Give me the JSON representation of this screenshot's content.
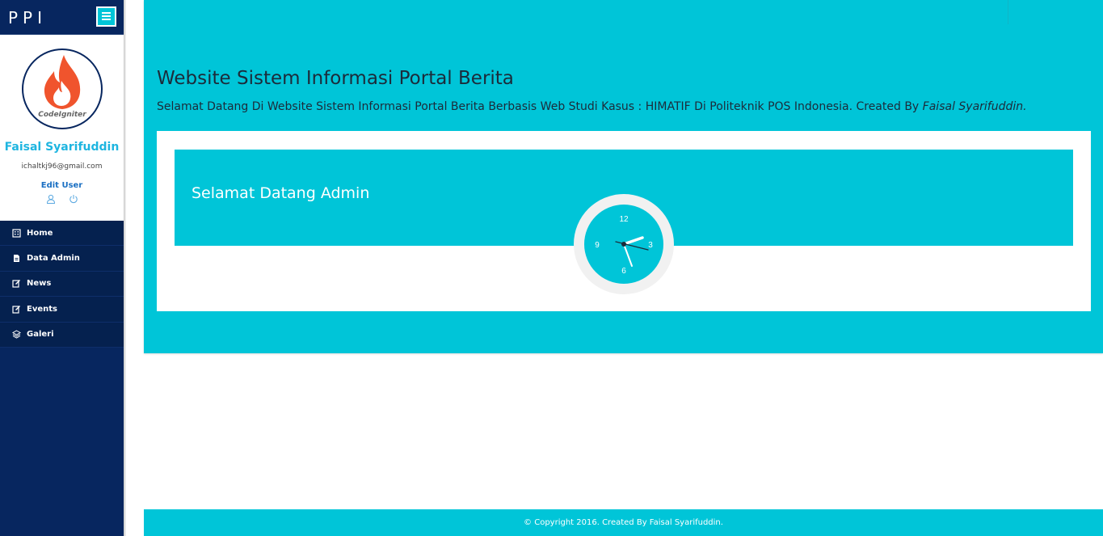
{
  "sidebar": {
    "brand": "PPI",
    "logo_text": "CodeIgniter",
    "user_name": "Faisal Syarifuddin",
    "user_email": "ichaltkj96@gmail.com",
    "edit_user_label": "Edit User",
    "items": [
      {
        "label": "Home",
        "icon": "building-icon"
      },
      {
        "label": "Data Admin",
        "icon": "file-icon"
      },
      {
        "label": "News",
        "icon": "edit-icon"
      },
      {
        "label": "Events",
        "icon": "edit-icon"
      },
      {
        "label": "Galeri",
        "icon": "layers-icon"
      }
    ]
  },
  "main": {
    "title": "Website Sistem Informasi Portal Berita",
    "subtitle": "Selamat Datang Di Website Sistem Informasi Portal Berita Berbasis Web Studi Kasus : HIMATIF Di Politeknik POS Indonesia. Created By",
    "subtitle_author": "Faisal Syarifuddin.",
    "welcome": "Selamat Datang Admin",
    "clock": {
      "n12": "12",
      "n3": "3",
      "n6": "6",
      "n9": "9"
    }
  },
  "footer": {
    "text": "© Copyright 2016. Created By Faisal Syarifuddin."
  },
  "colors": {
    "accent": "#00c5d8",
    "sidebar": "#07265f",
    "name": "#1eb5e0"
  }
}
